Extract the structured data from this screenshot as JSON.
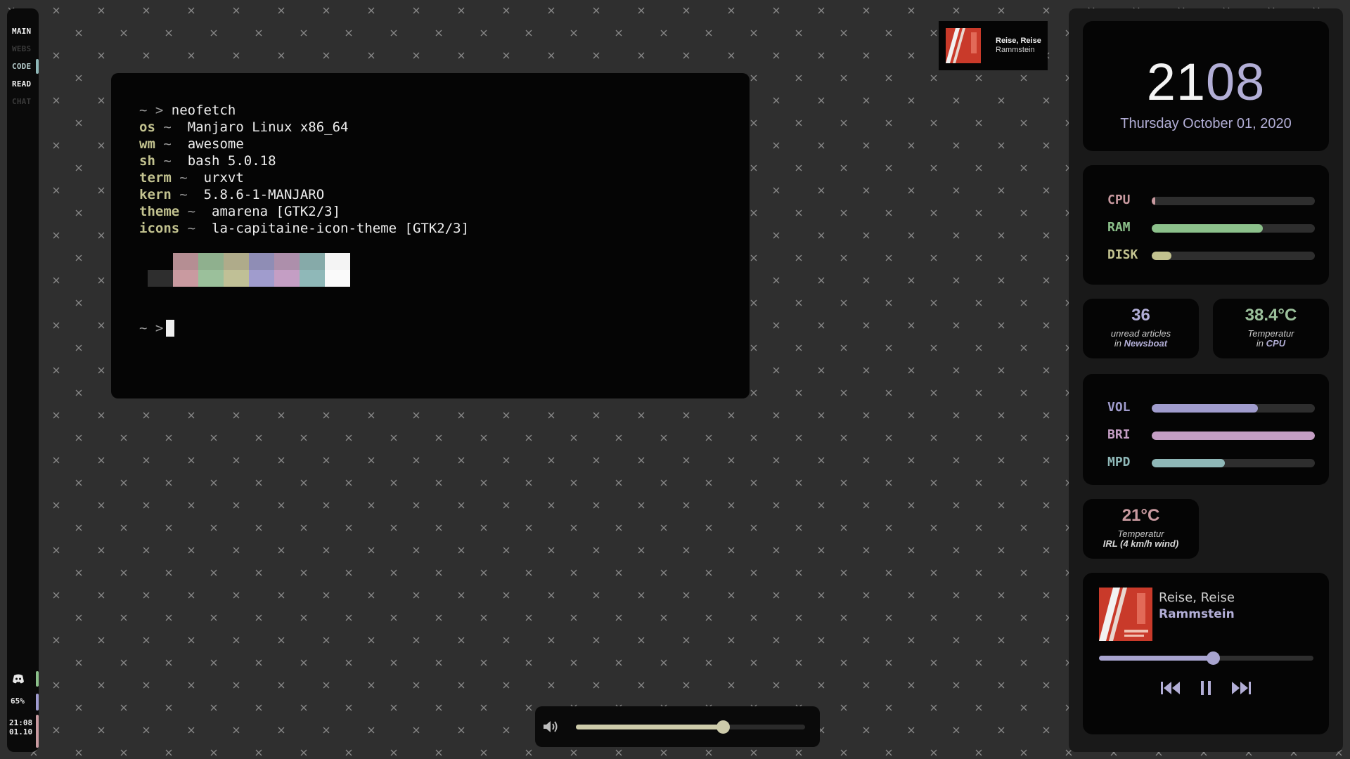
{
  "colors": {
    "background": "#2f2f2f",
    "accent_lavender": "#b2aed6",
    "accent_green": "#8cc18b",
    "accent_pink": "#c99aa0",
    "accent_teal": "#8fb8b8",
    "accent_olive": "#c2c28f"
  },
  "taglist": {
    "tags": [
      {
        "label": "MAIN",
        "state": "active"
      },
      {
        "label": "WEBS",
        "state": "empty"
      },
      {
        "label": "CODE",
        "state": "occupied"
      },
      {
        "label": "READ",
        "state": "urgent"
      },
      {
        "label": "CHAT",
        "state": "empty"
      }
    ]
  },
  "leftbar": {
    "discord_icon": "discord-icon",
    "battery": "65%",
    "time": "21:08",
    "date": "01.10"
  },
  "terminal": {
    "prompt": "~ >",
    "command": "neofetch",
    "separator": "~",
    "info": [
      {
        "key": "os",
        "value": "Manjaro Linux x86_64"
      },
      {
        "key": "wm",
        "value": "awesome"
      },
      {
        "key": "sh",
        "value": "bash 5.0.18"
      },
      {
        "key": "term",
        "value": "urxvt"
      },
      {
        "key": "kern",
        "value": "5.8.6-1-MANJARO"
      },
      {
        "key": "theme",
        "value": "amarena [GTK2/3]"
      },
      {
        "key": "icons",
        "value": "la-capitaine-icon-theme [GTK2/3]"
      }
    ],
    "palette_top": [
      "#050505",
      "#b58e93",
      "#8fb08e",
      "#afab8a",
      "#8f8db5",
      "#ad8fab",
      "#86aaa9",
      "#f4f4f4"
    ],
    "palette_bottom": [
      "#2e2e2e",
      "#c99aa0",
      "#9bc09b",
      "#c0c096",
      "#a09ccd",
      "#c49ec4",
      "#8fb8b8",
      "#fafafa"
    ]
  },
  "now_playing_mini": {
    "title": "Reise, Reise",
    "artist": "Rammstein"
  },
  "volume_osd": {
    "icon": "speaker-icon",
    "level": 0.64
  },
  "sidebar": {
    "clock": {
      "hours": "21",
      "minutes": "08"
    },
    "date": "Thursday October 01, 2020",
    "system": [
      {
        "label": "CPU",
        "value": 0.02,
        "color": "#c99aa0"
      },
      {
        "label": "RAM",
        "value": 0.68,
        "color": "#8cc18b"
      },
      {
        "label": "DISK",
        "value": 0.12,
        "color": "#c2c28f"
      }
    ],
    "newsboat": {
      "value": "36",
      "label": "unread articles",
      "prefix": "in",
      "source": "Newsboat",
      "color": "#b2aed6"
    },
    "cpu_temp": {
      "value": "38.4°C",
      "label": "Temperatur",
      "prefix": "in",
      "source": "CPU",
      "color": "#9bc09b"
    },
    "controls": [
      {
        "label": "VOL",
        "value": 0.65,
        "color": "#a09ccd"
      },
      {
        "label": "BRI",
        "value": 1.0,
        "color": "#c49ec4"
      },
      {
        "label": "MPD",
        "value": 0.45,
        "color": "#8fb8b8"
      }
    ],
    "weather": {
      "value": "21°C",
      "label": "Temperatur",
      "sub": "IRL (4 km/h wind)",
      "color": "#c99aa0"
    },
    "music": {
      "title": "Reise, Reise",
      "artist": "Rammstein",
      "progress": 0.53,
      "buttons": {
        "prev": "skip-previous-icon",
        "play": "pause-icon",
        "next": "skip-next-icon"
      }
    }
  }
}
